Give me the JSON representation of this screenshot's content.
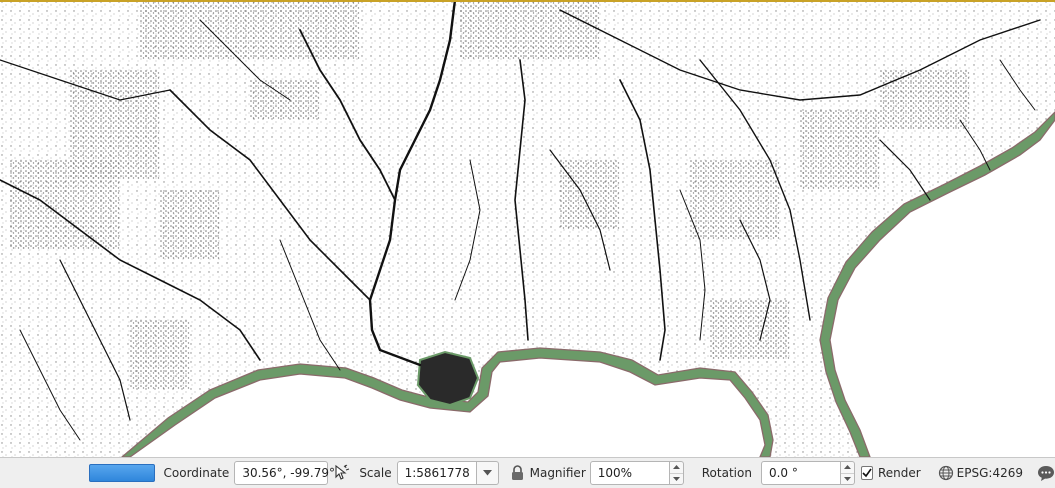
{
  "statusbar": {
    "progress_fraction": 1.0,
    "coordinate_label": "Coordinate",
    "coordinate_value": "30.56°, -99.79°",
    "scale_label": "Scale",
    "scale_value": "1:5861778",
    "magnifier_label": "Magnifier",
    "magnifier_value": "100%",
    "rotation_label": "Rotation",
    "rotation_value": "0.0 °",
    "render_label": "Render",
    "render_checked": true,
    "crs_label": "EPSG:4269"
  },
  "icons": {
    "render_toggle": "mouse-pointer-icon",
    "scale_lock": "lock-icon",
    "crs": "globe-icon",
    "messages": "speech-bubble-icon"
  },
  "colors": {
    "land": "#ffffff",
    "rivers": "#111111",
    "coast_fill": "#6b9a68",
    "coast_outline": "#8a6a6a",
    "sea": "#ffffff",
    "top_edge": "#c9a227",
    "progress": "#2f86db"
  }
}
